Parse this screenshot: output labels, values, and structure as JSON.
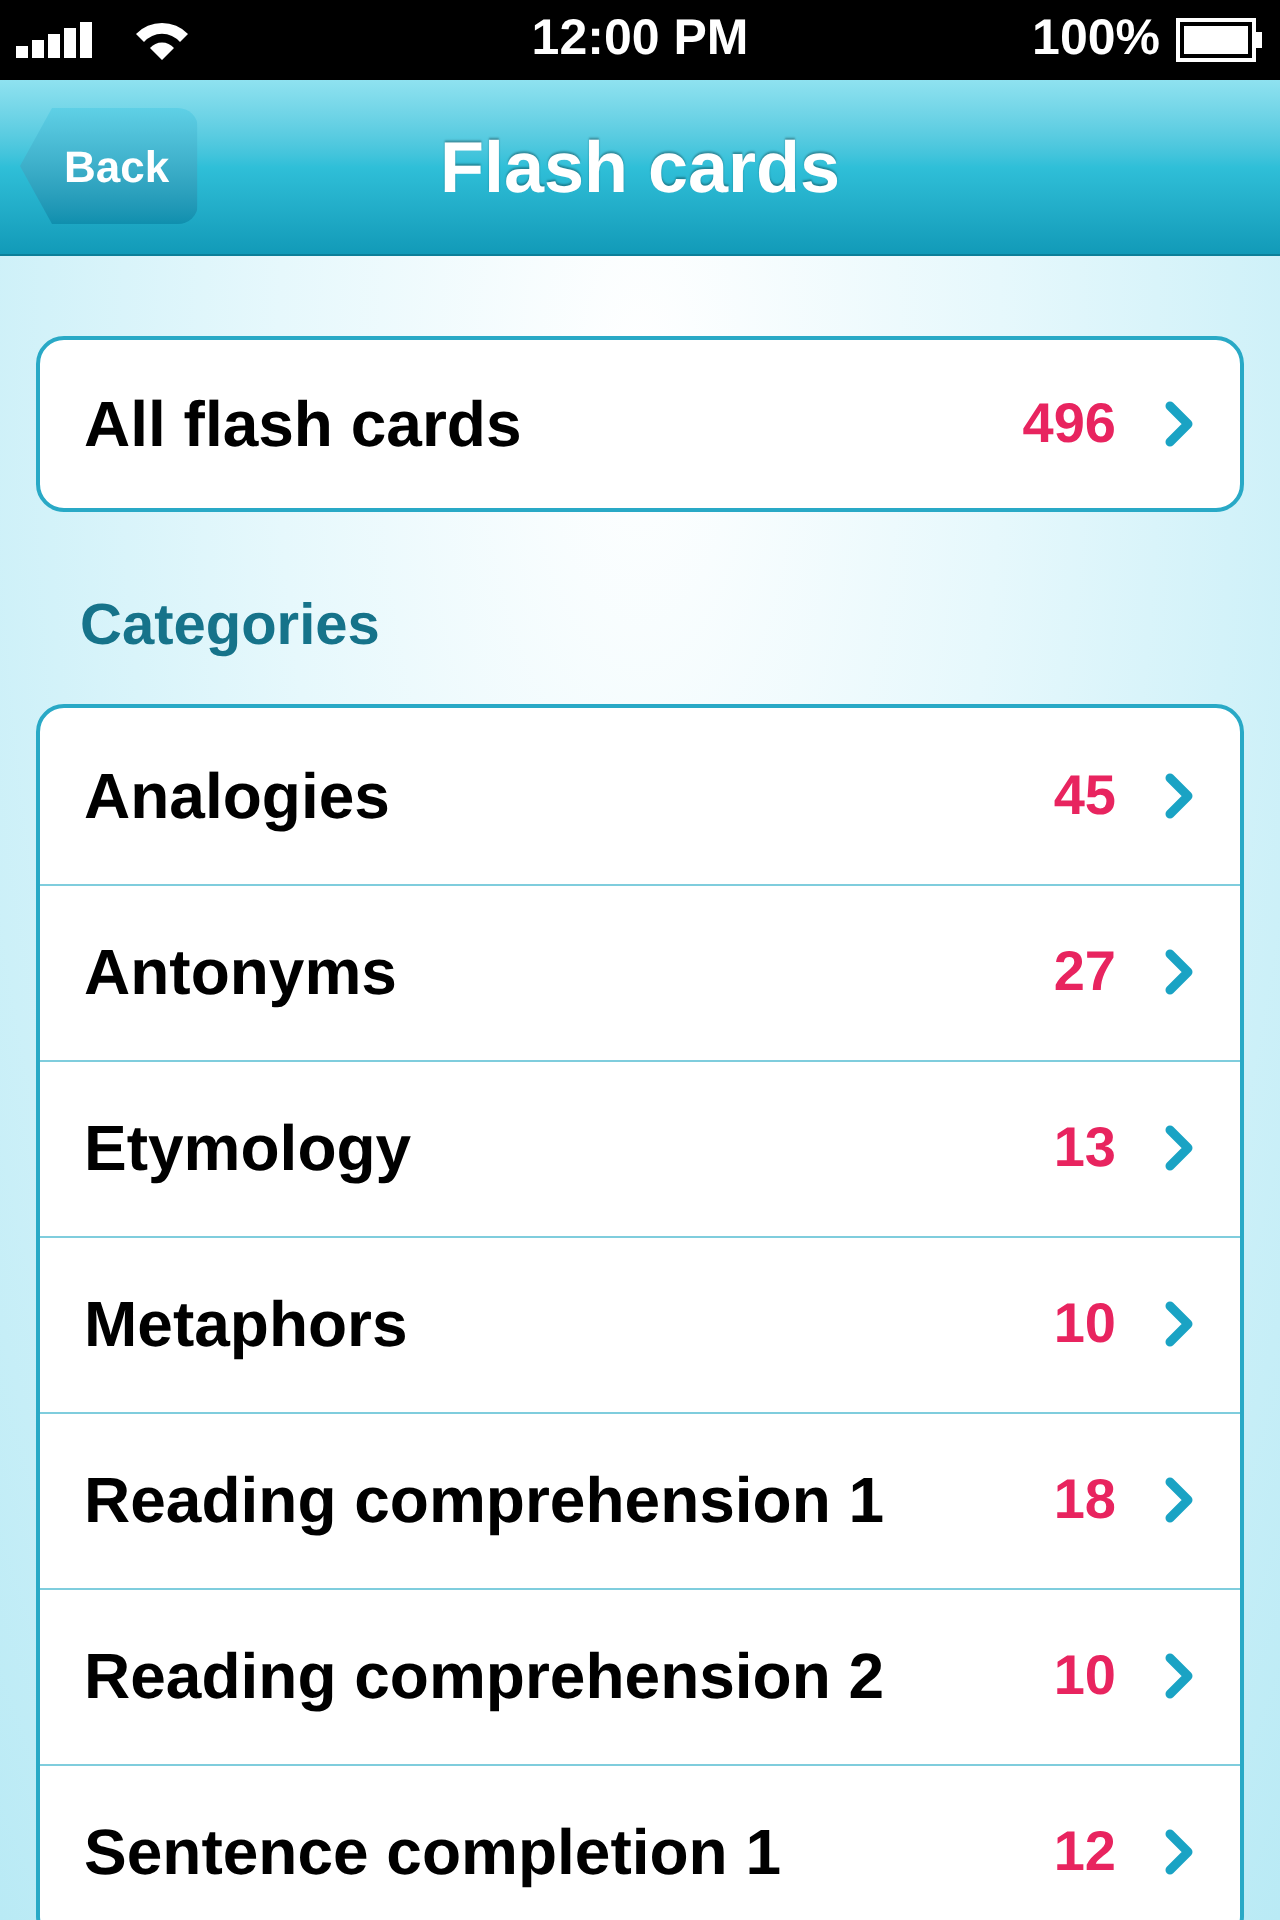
{
  "status_bar": {
    "time": "12:00 PM",
    "battery": "100%"
  },
  "nav_bar": {
    "back": "Back",
    "title": "Flash cards"
  },
  "all_cards": {
    "label": "All flash cards",
    "count": "496"
  },
  "section_title": "Categories",
  "categories": [
    {
      "label": "Analogies",
      "count": "45"
    },
    {
      "label": "Antonyms",
      "count": "27"
    },
    {
      "label": "Etymology",
      "count": "13"
    },
    {
      "label": "Metaphors",
      "count": "10"
    },
    {
      "label": "Reading comprehension 1",
      "count": "18"
    },
    {
      "label": "Reading comprehension 2",
      "count": "10"
    },
    {
      "label": "Sentence completion 1",
      "count": "12"
    }
  ]
}
